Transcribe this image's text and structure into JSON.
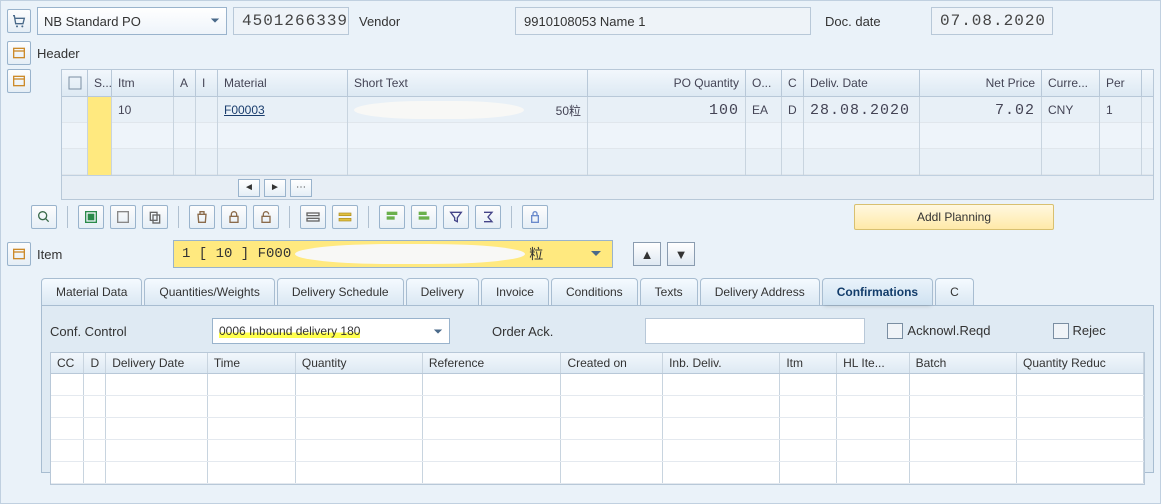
{
  "header": {
    "po_type": "NB Standard PO",
    "po_number": "4501266339",
    "vendor_label": "Vendor",
    "vendor_value": "9910108053 Name 1",
    "doc_date_label": "Doc. date",
    "doc_date": "07.08.2020",
    "expand_label": "Header"
  },
  "grid": {
    "cols": {
      "s": "S...",
      "itm": "Itm",
      "a": "A",
      "i": "I",
      "mat": "Material",
      "st": "Short Text",
      "qty": "PO Quantity",
      "o": "O...",
      "c": "C",
      "dd": "Deliv. Date",
      "np": "Net Price",
      "cur": "Curre...",
      "per": "Per"
    },
    "rows": [
      {
        "itm": "10",
        "mat": "F00003",
        "st_tail": "50粒",
        "qty": "100",
        "o": "EA",
        "c": "D",
        "dd": "28.08.2020",
        "np": "7.02",
        "cur": "CNY",
        "per": "1"
      }
    ]
  },
  "toolbar": {
    "addl": "Addl Planning"
  },
  "item": {
    "label": "Item",
    "selected": "1 [ 10 ] F000",
    "selected_tail": "粒"
  },
  "tabs": [
    "Material Data",
    "Quantities/Weights",
    "Delivery Schedule",
    "Delivery",
    "Invoice",
    "Conditions",
    "Texts",
    "Delivery Address",
    "Confirmations",
    "C"
  ],
  "active_tab": 8,
  "conf": {
    "cc_label": "Conf. Control",
    "cc_value": "0006 Inbound delivery 180",
    "order_ack": "Order Ack.",
    "ack_reqd": "Acknowl.Reqd",
    "reject": "Rejec",
    "cols": {
      "cc": "CC",
      "d": "D",
      "ddate": "Delivery Date",
      "time": "Time",
      "qty": "Quantity",
      "ref": "Reference",
      "co": "Created on",
      "inb": "Inb. Deliv.",
      "itm": "Itm",
      "hl": "HL Ite...",
      "batch": "Batch",
      "qr": "Quantity Reduc"
    }
  }
}
